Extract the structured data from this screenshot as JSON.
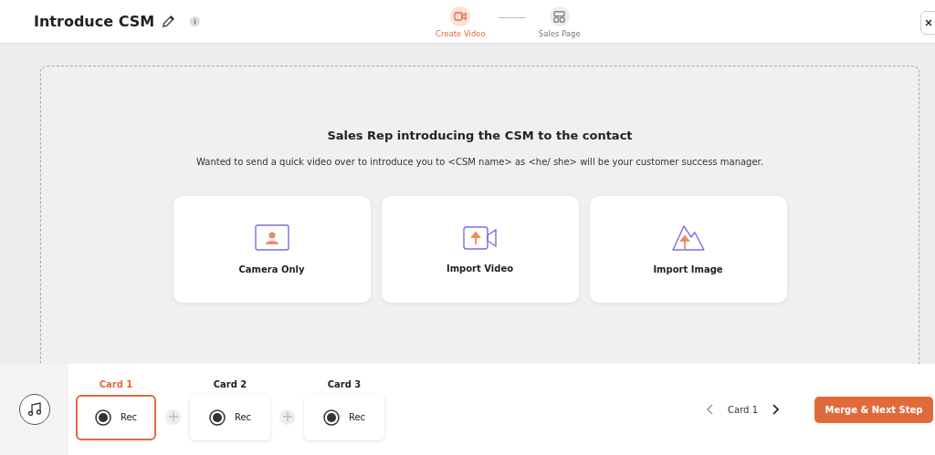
{
  "header": {
    "title": "Introduce CSM",
    "steps": [
      {
        "label": "Create Video",
        "kind": "video",
        "selected": true
      },
      {
        "label": "Sales Page",
        "kind": "layout",
        "selected": false
      }
    ]
  },
  "panel": {
    "heading": "Sales Rep introducing the CSM to the contact",
    "description": "Wanted to send a quick video over to introduce you to <CSM name> as <he/ she> will be your customer success manager.",
    "options": [
      {
        "label": "Camera Only",
        "kind": "camera"
      },
      {
        "label": "Import Video",
        "kind": "video"
      },
      {
        "label": "Import Image",
        "kind": "image"
      }
    ]
  },
  "cards": [
    {
      "label": "Card 1",
      "button": "Rec",
      "selected": true
    },
    {
      "label": "Card 2",
      "button": "Rec",
      "selected": false
    },
    {
      "label": "Card 3",
      "button": "Rec",
      "selected": false
    }
  ],
  "pager": {
    "label": "Card 1",
    "prev_disabled": true,
    "next_disabled": false
  },
  "primary_button": "Merge & Next Step"
}
